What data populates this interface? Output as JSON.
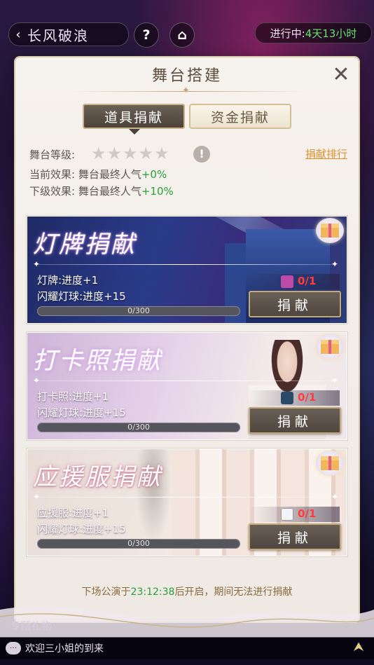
{
  "topbar": {
    "back_arrow": "‹",
    "title": "长风破浪",
    "help_glyph": "?",
    "home_glyph": "⌂",
    "status_label": "进行中:",
    "status_value": "4天13小时"
  },
  "panel": {
    "title": "舞台搭建",
    "close_glyph": "✕",
    "tabs": [
      {
        "label": "道具捐献",
        "active": true
      },
      {
        "label": "资金捐献",
        "active": false
      }
    ],
    "stage_level_label": "舞台等级:",
    "star_glyph": "★",
    "stars_filled": 0,
    "stars_total": 5,
    "warn_glyph": "!",
    "rank_link": "捐献排行",
    "current_effect_label": "当前效果:",
    "current_effect_text": "舞台最终人气",
    "current_effect_value": "+0%",
    "next_effect_label": "下级效果:",
    "next_effect_text": "舞台最终人气",
    "next_effect_value": "+10%"
  },
  "cards": [
    {
      "title": "灯牌捐献",
      "line1": "灯牌:进度+1",
      "line2": "闪耀灯球:进度+15",
      "progress_text": "0/300",
      "progress": 0,
      "item_count": "0/1",
      "button": "捐献",
      "item_icon": "light-sign-icon"
    },
    {
      "title": "打卡照捐献",
      "line1": "打卡照:进度+1",
      "line2": "闪耀灯球:进度+15",
      "progress_text": "0/300",
      "progress": 0,
      "item_count": "0/1",
      "button": "捐献",
      "item_icon": "photo-icon"
    },
    {
      "title": "应援服捐献",
      "line1": "应援服:进度+1",
      "line2": "闪耀灯球:进度+15",
      "progress_text": "0/300",
      "progress": 0,
      "item_count": "0/1",
      "button": "捐献",
      "item_icon": "support-shirt-icon"
    }
  ],
  "notice": {
    "prefix": "下场公演于",
    "time": "23:12:38",
    "suffix": "后开启，期间无法进行捐献"
  },
  "bottom": {
    "partial_label": "专题礼物",
    "chat_icon_glyph": "···",
    "chat_message": "欢迎三小姐的到来",
    "up_glyph": "⮝"
  },
  "colors": {
    "accent_green": "#27a03a",
    "status_green": "#5fe36a",
    "link_orange": "#e0902e",
    "count_red": "#ff3b3b",
    "button_gold": "#c4a977"
  }
}
